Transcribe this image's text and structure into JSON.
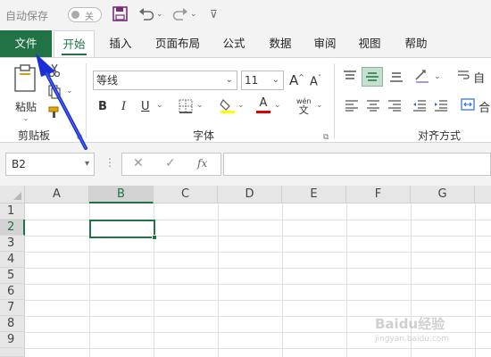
{
  "qat": {
    "autosave_label": "自动保存",
    "autosave_state": "关"
  },
  "tabs": [
    "文件",
    "开始",
    "插入",
    "页面布局",
    "公式",
    "数据",
    "审阅",
    "视图",
    "帮助"
  ],
  "ribbon": {
    "paste_label": "粘贴",
    "clipboard_group": "剪贴板",
    "font_name": "等线",
    "font_size": "11",
    "grow_font": "A",
    "shrink_font": "A",
    "phonetic_top": "wén",
    "phonetic_bottom": "文",
    "bold": "B",
    "italic": "I",
    "underline": "U",
    "font_color_letter": "A",
    "font_group": "字体",
    "alignment_group": "对齐方式",
    "wrap_partial": "自",
    "merge_partial": "合",
    "colors": {
      "highlight": "#ffff00",
      "font_color": "#e00000",
      "accent": "#217346"
    }
  },
  "formula_bar": {
    "name_box": "B2",
    "cancel_icon": "✕",
    "enter_icon": "✓",
    "fx": "fx",
    "formula": ""
  },
  "grid": {
    "columns": [
      "A",
      "B",
      "C",
      "D",
      "E",
      "F",
      "G"
    ],
    "rows": [
      "1",
      "2",
      "3",
      "4",
      "5",
      "6",
      "7",
      "8",
      "9"
    ],
    "selected_column": "B",
    "selected_row": "2"
  },
  "watermark": {
    "text": "Baidu经验",
    "sub": "jingyan.baidu.com"
  }
}
